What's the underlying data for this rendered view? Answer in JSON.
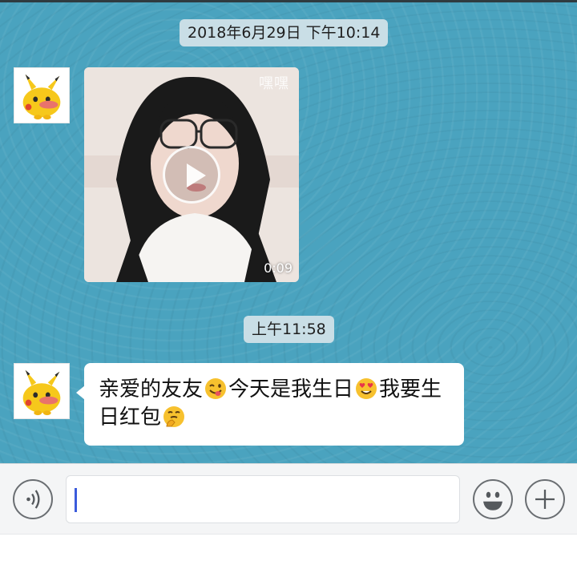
{
  "conversation": {
    "timestamp_1": "2018年6月29日 下午10:14",
    "video": {
      "duration": "0:09",
      "watermark": "嘿嘿"
    },
    "timestamp_2": "上午11:58",
    "message": {
      "part1": "亲爱的友友",
      "emoji1": "winking-tongue-emoji",
      "part2": "今天是我生日",
      "emoji2": "heart-eyes-emoji",
      "part3": "我要生日红包",
      "emoji3": "thinking-emoji"
    }
  },
  "input_bar": {
    "voice_icon": "voice-icon",
    "text_value": "",
    "emoji_icon": "smiley-icon",
    "add_icon": "plus-icon"
  },
  "colors": {
    "chat_background": "#4aa3bf",
    "bubble": "#ffffff",
    "timestamp_background": "#c9dee6",
    "caret": "#3b5bdb"
  }
}
